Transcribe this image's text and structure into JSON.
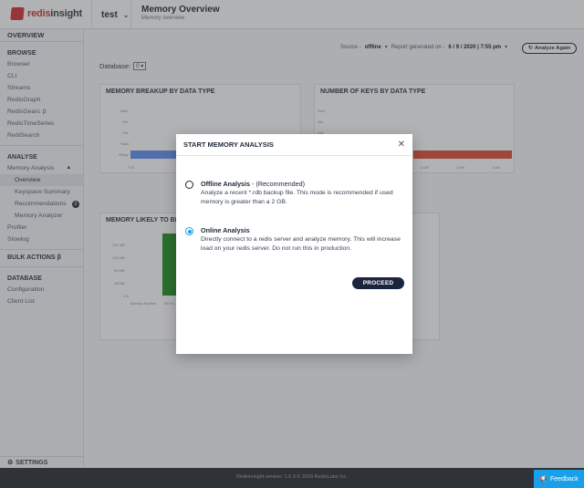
{
  "header": {
    "logo_prefix": "redis",
    "logo_suffix": "insight",
    "database_name": "test",
    "page_title": "Memory Overview",
    "page_subtitle": "Memory overview"
  },
  "sidebar": {
    "overview": "OVERVIEW",
    "browse_title": "BROWSE",
    "browse_items": [
      "Browser",
      "CLI",
      "Streams",
      "RedisGraph",
      "RedisGears",
      "RedisTimeSeries",
      "RediSearch"
    ],
    "analyse_title": "ANALYSE",
    "memory_analysis": "Memory Analysis",
    "sub_overview": "Overview",
    "sub_keyspace": "Keyspace Summary",
    "sub_recommendations": "Recommendations",
    "recommendations_count": "3",
    "sub_memory_analyzer": "Memory Analyzer",
    "profiler": "Profiler",
    "slowlog": "Slowlog",
    "bulk_actions": "BULK ACTIONS",
    "database_title": "DATABASE",
    "configuration": "Configuration",
    "client_list": "Client List",
    "settings": "SETTINGS"
  },
  "main": {
    "source_label": "Source -",
    "source_value": "offline",
    "report_label": "Report generated on -",
    "report_value": "6 / 9 / 2020 | 7:55 pm",
    "analyze_again": "Analyze Again",
    "database_label": "Database:",
    "database_value": "0",
    "card1_title": "MEMORY BREAKUP BY DATA TYPE",
    "card1_types": [
      "Zset",
      "Set",
      "List",
      "Hash",
      "String"
    ],
    "card1_xticks": [
      "0 B"
    ],
    "card2_title": "NUMBER OF KEYS BY DATA TYPE",
    "card2_types": [
      "Zset",
      "Set",
      "List",
      "Hash",
      "String"
    ],
    "card2_xticks": [
      "2.0M",
      "3.0M",
      "4.0M"
    ],
    "card3_title": "MEMORY LIKELY TO BE",
    "card3_yticks": [
      "191 MB",
      "143 MB",
      "95 MB",
      "48 MB",
      "0 B"
    ],
    "card3_xlabels": [
      "Already Expired",
      "No Ex"
    ]
  },
  "modal": {
    "title": "START MEMORY ANALYSIS",
    "offline_title": "Offline Analysis",
    "offline_suffix": " - (Recommended)",
    "offline_desc": "Analyze a recent *.rdb backup file. This mode is recommended if used memory is greater than a 2 GB.",
    "online_title": "Online Analysis",
    "online_desc": "Directly connect to a redis server and analyze memory. This will increase load on your redis server. Do not run this in production.",
    "selected": "online",
    "proceed": "PROCEED"
  },
  "footer": {
    "version": "RedisInsight version: 1.6.3 © 2020 RedisLabs Inc.",
    "feedback": "Feedback"
  },
  "colors": {
    "brand_red": "#d12a2a",
    "accent_blue": "#1aa0e8",
    "proceed_bg": "#1c2540",
    "bar_blue": "#5b8def",
    "bar_red": "#e0452e",
    "bar_green": "#1b8a1b"
  }
}
